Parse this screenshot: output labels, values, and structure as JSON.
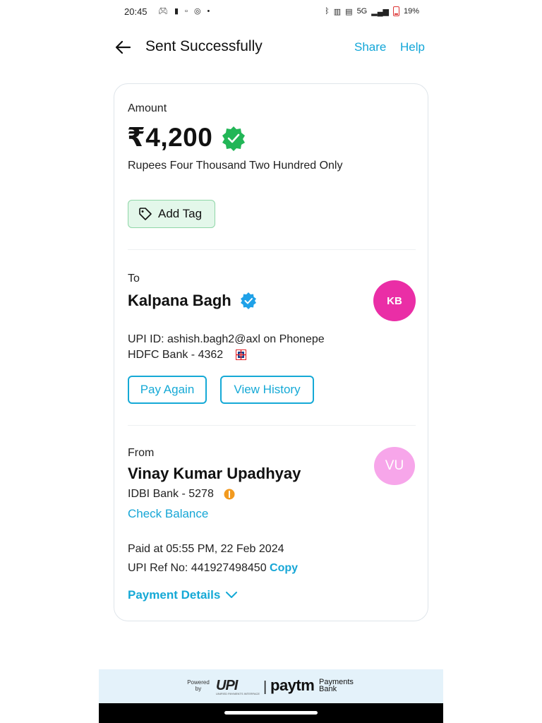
{
  "status_bar": {
    "time": "20:45",
    "network": "5G",
    "battery": "19%"
  },
  "header": {
    "title": "Sent Successfully",
    "share_label": "Share",
    "help_label": "Help"
  },
  "amount_section": {
    "label": "Amount",
    "amount": "₹4,200",
    "amount_in_words": "Rupees Four Thousand Two Hundred Only",
    "add_tag_label": "Add Tag",
    "verified_color": "#22b657"
  },
  "to_section": {
    "label": "To",
    "name": "Kalpana Bagh",
    "avatar_initials": "KB",
    "avatar_color": "#ea2ea6",
    "upi_id_line": "UPI ID: ashish.bagh2@axl on Phonepe",
    "bank_line": "HDFC Bank - 4362",
    "pay_again_label": "Pay Again",
    "view_history_label": "View History"
  },
  "from_section": {
    "label": "From",
    "name": "Vinay Kumar Upadhyay",
    "avatar_initials": "VU",
    "avatar_color": "#f7a6ea",
    "bank_line": "IDBI Bank - 5278",
    "check_balance_label": "Check Balance",
    "paid_at": "Paid at 05:55 PM, 22 Feb 2024",
    "upi_ref": "UPI Ref No: 441927498450",
    "copy_label": "Copy",
    "payment_details_label": "Payment Details"
  },
  "footer": {
    "powered_by": "Powered by",
    "upi_logo": "UPI",
    "upi_subtitle": "UNIFIED PAYMENTS INTERFACE",
    "separator": "|",
    "paytm_logo": "paytm",
    "payments_bank": "Payments Bank"
  },
  "accent_color": "#15a9d6"
}
